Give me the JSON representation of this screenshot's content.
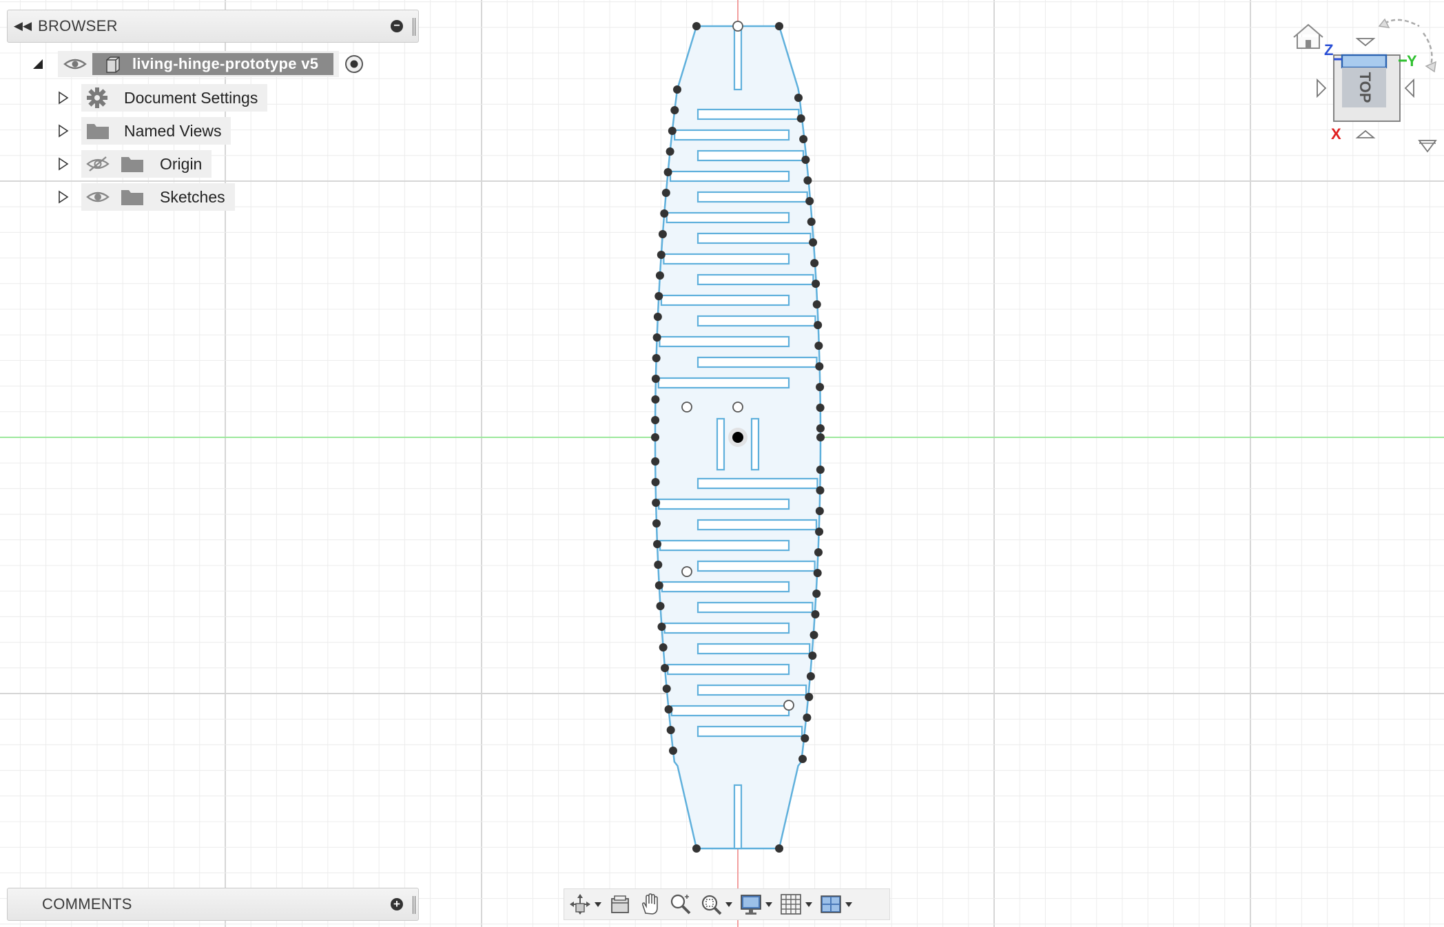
{
  "browser": {
    "title": "BROWSER",
    "root": {
      "name": "living-hinge-prototype v5"
    },
    "items": [
      {
        "label": "Document Settings",
        "icon": "gear-icon"
      },
      {
        "label": "Named Views",
        "icon": "folder-icon"
      },
      {
        "label": "Origin",
        "icon": "folder-icon",
        "visibility": "hidden"
      },
      {
        "label": "Sketches",
        "icon": "folder-icon",
        "visibility": "visible"
      }
    ]
  },
  "comments": {
    "title": "COMMENTS"
  },
  "viewcube": {
    "face_label": "TOP",
    "axes": {
      "z": "Z",
      "y": "Y",
      "x": "X"
    }
  },
  "toolbar": {
    "tools": [
      "orbit-icon",
      "look-at-icon",
      "pan-icon",
      "zoom-icon",
      "fit-icon",
      "display-settings-icon",
      "grid-settings-icon",
      "viewports-icon"
    ]
  },
  "colors": {
    "sketch_profile": "#5fb0dc",
    "sketch_fill": "#eef6fc",
    "x_axis": "#9be89b",
    "y_axis": "#f2a0a0",
    "grid_minor": "#ececec",
    "grid_major": "#d6d6d6"
  }
}
